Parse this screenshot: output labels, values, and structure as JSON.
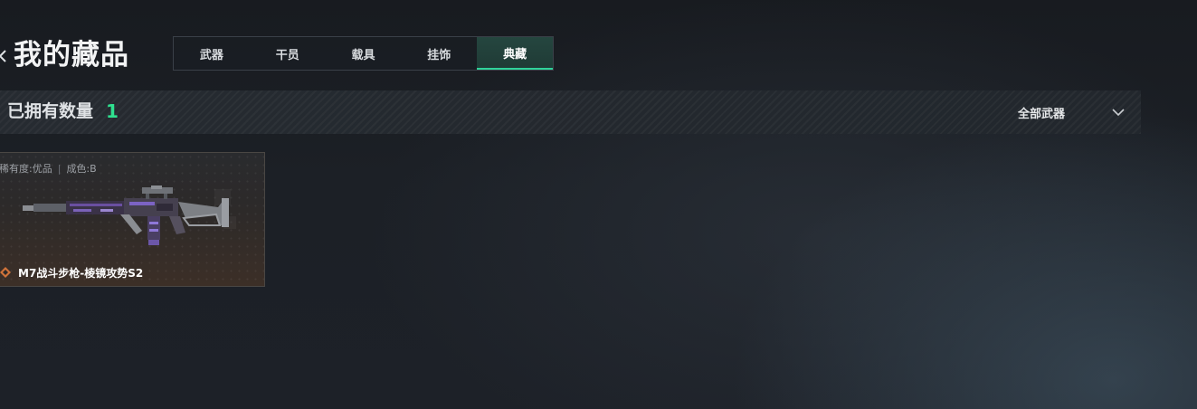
{
  "header": {
    "title": "我的藏品",
    "back_icon": "chevron-left-icon"
  },
  "tabs": [
    {
      "label": "武器",
      "active": false
    },
    {
      "label": "干员",
      "active": false
    },
    {
      "label": "载具",
      "active": false
    },
    {
      "label": "挂饰",
      "active": false
    },
    {
      "label": "典藏",
      "active": true
    }
  ],
  "owned": {
    "label": "已拥有数量",
    "count": "1"
  },
  "filter": {
    "selected": "全部武器",
    "icon": "chevron-down-icon"
  },
  "items": [
    {
      "rarity": "稀有度:优品",
      "condition": "成色:B",
      "name": "M7战斗步枪-棱镜攻势S2",
      "rarity_icon": "diamond-rarity-icon",
      "image": "rifle-image"
    }
  ],
  "colors": {
    "accent": "#2fe08f",
    "tab_active_underline": "#2fd39a",
    "rarity": "#d0733a"
  }
}
